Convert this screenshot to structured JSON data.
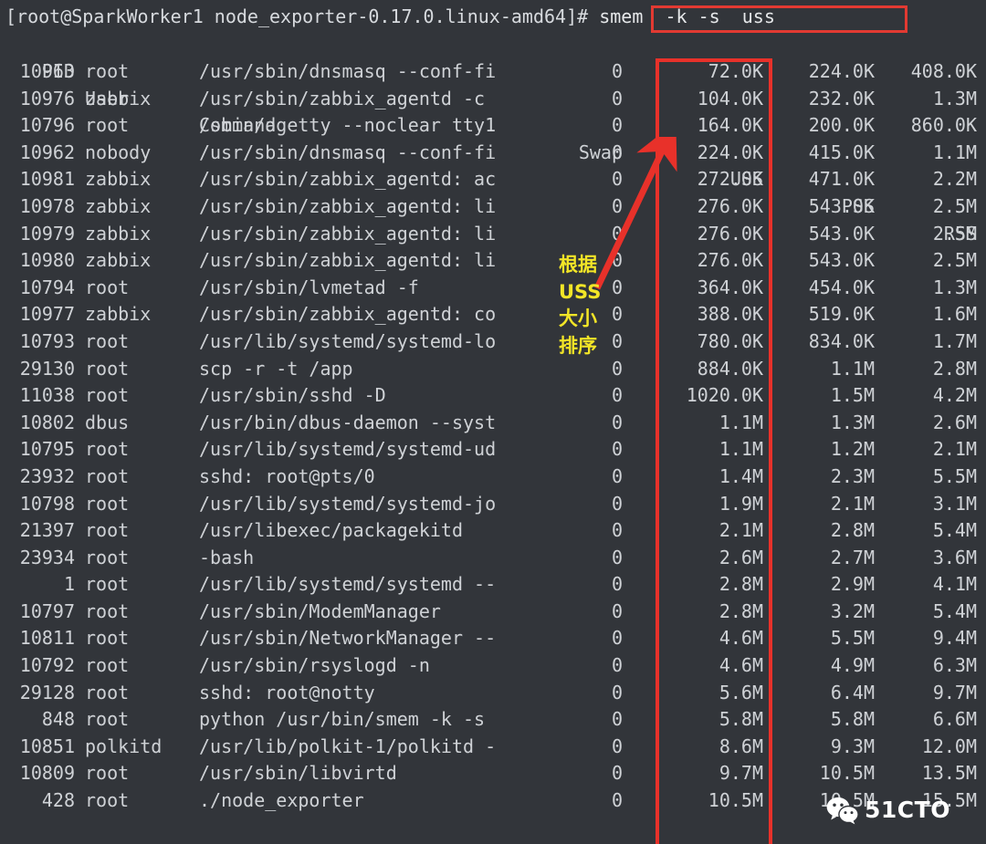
{
  "terminal": {
    "background_color": "#32353a",
    "text_color": "#cfd2d6",
    "prompt": "[root@SparkWorker1 node_exporter-0.17.0.linux-amd64]# ",
    "command": "smem  -k -s  uss",
    "headers": {
      "pid": "PID",
      "user": "User",
      "command": "Command",
      "swap": "Swap",
      "uss": "USS",
      "pss": "PSS",
      "rss": "RSS"
    },
    "rows": [
      {
        "pid": "10963",
        "user": "root",
        "command": "/usr/sbin/dnsmasq --conf-fi",
        "swap": "0",
        "uss": "72.0K",
        "pss": "224.0K",
        "rss": "408.0K"
      },
      {
        "pid": "10976",
        "user": "zabbix",
        "command": "/usr/sbin/zabbix_agentd -c",
        "swap": "0",
        "uss": "104.0K",
        "pss": "232.0K",
        "rss": "1.3M"
      },
      {
        "pid": "10796",
        "user": "root",
        "command": "/sbin/agetty --noclear tty1",
        "swap": "0",
        "uss": "164.0K",
        "pss": "200.0K",
        "rss": "860.0K"
      },
      {
        "pid": "10962",
        "user": "nobody",
        "command": "/usr/sbin/dnsmasq --conf-fi",
        "swap": "0",
        "uss": "224.0K",
        "pss": "415.0K",
        "rss": "1.1M"
      },
      {
        "pid": "10981",
        "user": "zabbix",
        "command": "/usr/sbin/zabbix_agentd: ac",
        "swap": "0",
        "uss": "272.0K",
        "pss": "471.0K",
        "rss": "2.2M"
      },
      {
        "pid": "10978",
        "user": "zabbix",
        "command": "/usr/sbin/zabbix_agentd: li",
        "swap": "0",
        "uss": "276.0K",
        "pss": "543.0K",
        "rss": "2.5M"
      },
      {
        "pid": "10979",
        "user": "zabbix",
        "command": "/usr/sbin/zabbix_agentd: li",
        "swap": "0",
        "uss": "276.0K",
        "pss": "543.0K",
        "rss": "2.5M"
      },
      {
        "pid": "10980",
        "user": "zabbix",
        "command": "/usr/sbin/zabbix_agentd: li",
        "swap": "0",
        "uss": "276.0K",
        "pss": "543.0K",
        "rss": "2.5M"
      },
      {
        "pid": "10794",
        "user": "root",
        "command": "/usr/sbin/lvmetad -f",
        "swap": "0",
        "uss": "364.0K",
        "pss": "454.0K",
        "rss": "1.3M"
      },
      {
        "pid": "10977",
        "user": "zabbix",
        "command": "/usr/sbin/zabbix_agentd: co",
        "swap": "0",
        "uss": "388.0K",
        "pss": "519.0K",
        "rss": "1.6M"
      },
      {
        "pid": "10793",
        "user": "root",
        "command": "/usr/lib/systemd/systemd-lo",
        "swap": "0",
        "uss": "780.0K",
        "pss": "834.0K",
        "rss": "1.7M"
      },
      {
        "pid": "29130",
        "user": "root",
        "command": "scp -r -t /app",
        "swap": "0",
        "uss": "884.0K",
        "pss": "1.1M",
        "rss": "2.8M"
      },
      {
        "pid": "11038",
        "user": "root",
        "command": "/usr/sbin/sshd -D",
        "swap": "0",
        "uss": "1020.0K",
        "pss": "1.5M",
        "rss": "4.2M"
      },
      {
        "pid": "10802",
        "user": "dbus",
        "command": "/usr/bin/dbus-daemon --syst",
        "swap": "0",
        "uss": "1.1M",
        "pss": "1.3M",
        "rss": "2.6M"
      },
      {
        "pid": "10795",
        "user": "root",
        "command": "/usr/lib/systemd/systemd-ud",
        "swap": "0",
        "uss": "1.1M",
        "pss": "1.2M",
        "rss": "2.1M"
      },
      {
        "pid": "23932",
        "user": "root",
        "command": "sshd: root@pts/0",
        "swap": "0",
        "uss": "1.4M",
        "pss": "2.3M",
        "rss": "5.5M"
      },
      {
        "pid": "10798",
        "user": "root",
        "command": "/usr/lib/systemd/systemd-jo",
        "swap": "0",
        "uss": "1.9M",
        "pss": "2.1M",
        "rss": "3.1M"
      },
      {
        "pid": "21397",
        "user": "root",
        "command": "/usr/libexec/packagekitd",
        "swap": "0",
        "uss": "2.1M",
        "pss": "2.8M",
        "rss": "5.4M"
      },
      {
        "pid": "23934",
        "user": "root",
        "command": "-bash",
        "swap": "0",
        "uss": "2.6M",
        "pss": "2.7M",
        "rss": "3.6M"
      },
      {
        "pid": "1",
        "user": "root",
        "command": "/usr/lib/systemd/systemd --",
        "swap": "0",
        "uss": "2.8M",
        "pss": "2.9M",
        "rss": "4.1M"
      },
      {
        "pid": "10797",
        "user": "root",
        "command": "/usr/sbin/ModemManager",
        "swap": "0",
        "uss": "2.8M",
        "pss": "3.2M",
        "rss": "5.4M"
      },
      {
        "pid": "10811",
        "user": "root",
        "command": "/usr/sbin/NetworkManager --",
        "swap": "0",
        "uss": "4.6M",
        "pss": "5.5M",
        "rss": "9.4M"
      },
      {
        "pid": "10792",
        "user": "root",
        "command": "/usr/sbin/rsyslogd -n",
        "swap": "0",
        "uss": "4.6M",
        "pss": "4.9M",
        "rss": "6.3M"
      },
      {
        "pid": "29128",
        "user": "root",
        "command": "sshd: root@notty",
        "swap": "0",
        "uss": "5.6M",
        "pss": "6.4M",
        "rss": "9.7M"
      },
      {
        "pid": "848",
        "user": "root",
        "command": "python /usr/bin/smem -k -s",
        "swap": "0",
        "uss": "5.8M",
        "pss": "5.8M",
        "rss": "6.6M"
      },
      {
        "pid": "10851",
        "user": "polkitd",
        "command": "/usr/lib/polkit-1/polkitd -",
        "swap": "0",
        "uss": "8.6M",
        "pss": "9.3M",
        "rss": "12.0M"
      },
      {
        "pid": "10809",
        "user": "root",
        "command": "/usr/sbin/libvirtd",
        "swap": "0",
        "uss": "9.7M",
        "pss": "10.5M",
        "rss": "13.5M"
      },
      {
        "pid": "428",
        "user": "root",
        "command": "./node_exporter",
        "swap": "0",
        "uss": "10.5M",
        "pss": "10.5M",
        "rss": "15.5M"
      }
    ]
  },
  "annotations": {
    "highlight_color": "#e8312a",
    "caption_color": "#f2e527",
    "caption_lines": [
      "根据",
      "USS",
      "大小",
      "排序"
    ],
    "caption_full": "根据 USS 大小 排序"
  },
  "watermark": {
    "text": "51CTO"
  }
}
